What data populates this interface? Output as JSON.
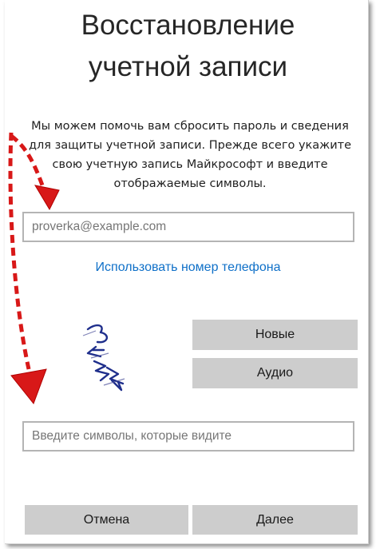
{
  "title": {
    "line1": "Восстановление",
    "line2": "учетной записи"
  },
  "description": "Мы можем помочь вам сбросить пароль и сведения для защиты учетной записи. Прежде всего укажите свою учетную запись Майкрософт и введите отображаемые символы.",
  "email": {
    "value": "",
    "placeholder": "proverka@example.com"
  },
  "phone_link": "Использовать номер телефона",
  "captcha": {
    "new_label": "Новые",
    "audio_label": "Аудио",
    "input_placeholder": "Введите символы, которые видите",
    "input_value": ""
  },
  "actions": {
    "cancel_label": "Отмена",
    "next_label": "Далее"
  },
  "colors": {
    "link": "#0f70c8",
    "button_bg": "#cdcdcd",
    "annotation_arrow": "#e01818"
  },
  "icons": {
    "captcha": "captcha-image",
    "annotation": "dashed-arrow-icon"
  }
}
